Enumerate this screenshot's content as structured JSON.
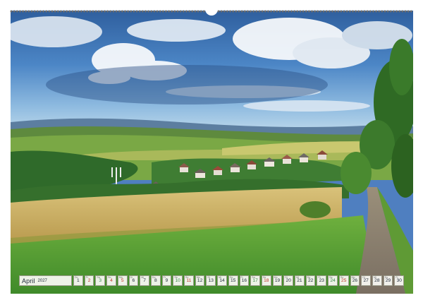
{
  "calendar": {
    "month": "April",
    "year": "2027",
    "days": [
      {
        "n": "1",
        "wd": "Do",
        "type": "weekday"
      },
      {
        "n": "2",
        "wd": "Fr",
        "type": "holiday"
      },
      {
        "n": "3",
        "wd": "Sa",
        "type": "sat"
      },
      {
        "n": "4",
        "wd": "So",
        "type": "sun"
      },
      {
        "n": "5",
        "wd": "Mo",
        "type": "holiday"
      },
      {
        "n": "6",
        "wd": "Di",
        "type": "weekday"
      },
      {
        "n": "7",
        "wd": "Mi",
        "type": "weekday"
      },
      {
        "n": "8",
        "wd": "Do",
        "type": "weekday"
      },
      {
        "n": "9",
        "wd": "Fr",
        "type": "weekday"
      },
      {
        "n": "10",
        "wd": "Sa",
        "type": "sat"
      },
      {
        "n": "11",
        "wd": "So",
        "type": "sun"
      },
      {
        "n": "12",
        "wd": "Mo",
        "type": "weekday"
      },
      {
        "n": "13",
        "wd": "Di",
        "type": "weekday"
      },
      {
        "n": "14",
        "wd": "Mi",
        "type": "weekday"
      },
      {
        "n": "15",
        "wd": "Do",
        "type": "weekday"
      },
      {
        "n": "16",
        "wd": "Fr",
        "type": "weekday"
      },
      {
        "n": "17",
        "wd": "Sa",
        "type": "sat"
      },
      {
        "n": "18",
        "wd": "So",
        "type": "sun"
      },
      {
        "n": "19",
        "wd": "Mo",
        "type": "weekday"
      },
      {
        "n": "20",
        "wd": "Di",
        "type": "weekday"
      },
      {
        "n": "21",
        "wd": "Mi",
        "type": "weekday"
      },
      {
        "n": "22",
        "wd": "Do",
        "type": "weekday"
      },
      {
        "n": "23",
        "wd": "Fr",
        "type": "weekday"
      },
      {
        "n": "24",
        "wd": "Sa",
        "type": "sat"
      },
      {
        "n": "25",
        "wd": "So",
        "type": "sun"
      },
      {
        "n": "26",
        "wd": "Mo",
        "type": "weekday"
      },
      {
        "n": "27",
        "wd": "Di",
        "type": "weekday"
      },
      {
        "n": "28",
        "wd": "Mi",
        "type": "weekday"
      },
      {
        "n": "29",
        "wd": "Do",
        "type": "weekday"
      },
      {
        "n": "30",
        "wd": "Fr",
        "type": "weekday"
      }
    ]
  },
  "colors": {
    "saturday": "#3a8a4a",
    "sunday_holiday": "#c0392b",
    "text": "#1e2a3a"
  }
}
